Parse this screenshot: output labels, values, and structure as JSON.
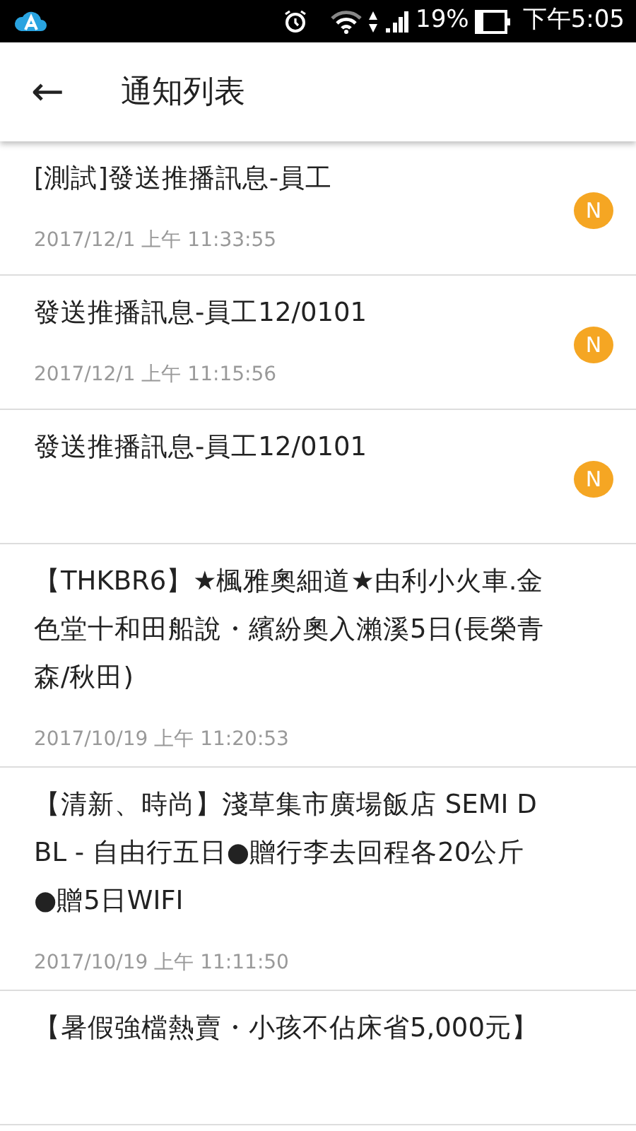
{
  "status_bar": {
    "battery_text": "19%",
    "time": "下午5:05"
  },
  "app_bar": {
    "back": "←",
    "title": "通知列表"
  },
  "notifications": [
    {
      "title": "[測試]發送推播訊息-員工",
      "date": "2017/12/1 上午 11:33:55",
      "badge": "N"
    },
    {
      "title": "發送推播訊息-員工12/0101",
      "date": "2017/12/1 上午 11:15:56",
      "badge": "N"
    },
    {
      "title": "發送推播訊息-員工12/0101",
      "badge": "N"
    },
    {
      "title": "【THKBR6】★楓雅奧細道★由利小火車.金色堂十和田船說・繽紛奧入瀨溪5日(長榮青森/秋田)",
      "date": "2017/10/19 上午 11:20:53"
    },
    {
      "title": "【清新、時尚】淺草集市廣場飯店 SEMI DBL - 自由行五日●贈行李去回程各20公斤●贈5日WIFI",
      "date": "2017/10/19 上午 11:11:50"
    },
    {
      "title": "【暑假強檔熱賣・小孩不佔床省5,000元】"
    }
  ]
}
